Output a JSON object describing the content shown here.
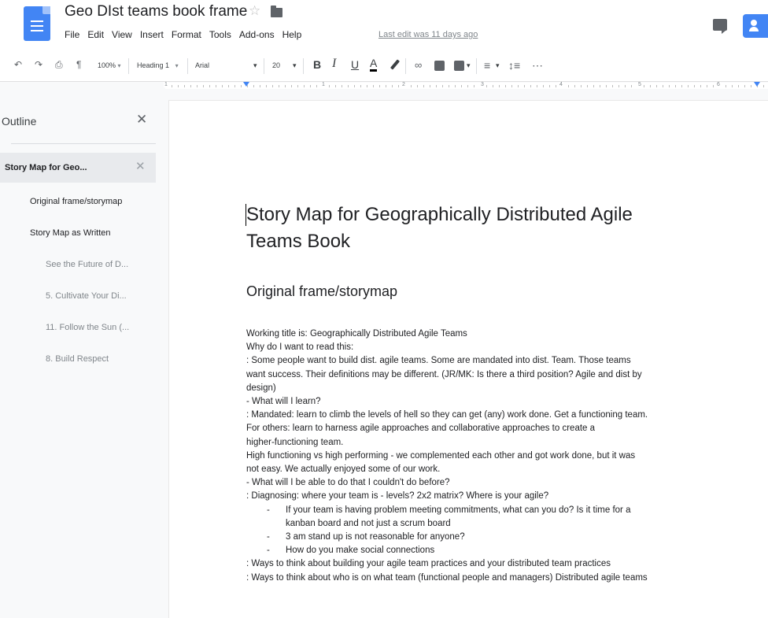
{
  "header": {
    "title": "Geo DIst teams book frame",
    "menu": [
      "File",
      "Edit",
      "View",
      "Insert",
      "Format",
      "Tools",
      "Add-ons",
      "Help"
    ],
    "last_edit": "Last edit was 11 days ago"
  },
  "toolbar": {
    "zoom": "100%",
    "style": "Heading 1",
    "font": "Arial",
    "size": "20",
    "bold": "B",
    "italic": "I",
    "underline": "U",
    "text_color": "A",
    "more": "⋯"
  },
  "ruler": {
    "numbers": [
      "1",
      "1",
      "2",
      "3",
      "4",
      "5",
      "6"
    ]
  },
  "outline": {
    "title": "Outline",
    "items": [
      {
        "label": "Story Map for Geo...",
        "level": 1
      },
      {
        "label": "Original frame/storymap",
        "level": 2
      },
      {
        "label": "Story Map as Written",
        "level": 2
      },
      {
        "label": "See the Future of D...",
        "level": 3
      },
      {
        "label": "5. Cultivate Your Di...",
        "level": 3
      },
      {
        "label": "11. Follow the Sun (...",
        "level": 3
      },
      {
        "label": "8. Build Respect",
        "level": 3
      }
    ]
  },
  "document": {
    "title_line1": "Story Map for Geographically Distributed Agile",
    "title_line2": "Teams Book",
    "heading2": "Original frame/storymap",
    "lines": [
      "Working title is: Geographically Distributed Agile Teams",
      "Why do I want to read this:",
      ": Some people want to build dist. agile teams. Some are mandated into dist. Team. Those teams",
      "want success. Their definitions may be different. (JR/MK: Is there a third position? Agile and dist by",
      "design)",
      "- What will I learn?",
      ": Mandated: learn to climb the levels of hell so they can get (any) work done. Get a functioning team.",
      "For others: learn to harness agile approaches and collaborative approaches to create a",
      "higher-functioning team.",
      "High functioning vs high performing - we complemented each other and got work done, but it was",
      "not easy.  We actually enjoyed some of our work.",
      "- What will I be able to do that I couldn't do before?",
      ": Diagnosing: where your team is - levels? 2x2 matrix? Where is your agile?"
    ],
    "bullets": [
      "If your team is having problem meeting commitments, what can you do?  Is it time for a",
      "3 am stand up is not reasonable for anyone?",
      "How do you make social connections"
    ],
    "bullet1_cont": "kanban board and not just a scrum board",
    "tail_lines": [
      ": Ways to think about building your agile team practices and your distributed team practices",
      ": Ways to think about who is on what team (functional people and managers) Distributed agile teams"
    ]
  }
}
